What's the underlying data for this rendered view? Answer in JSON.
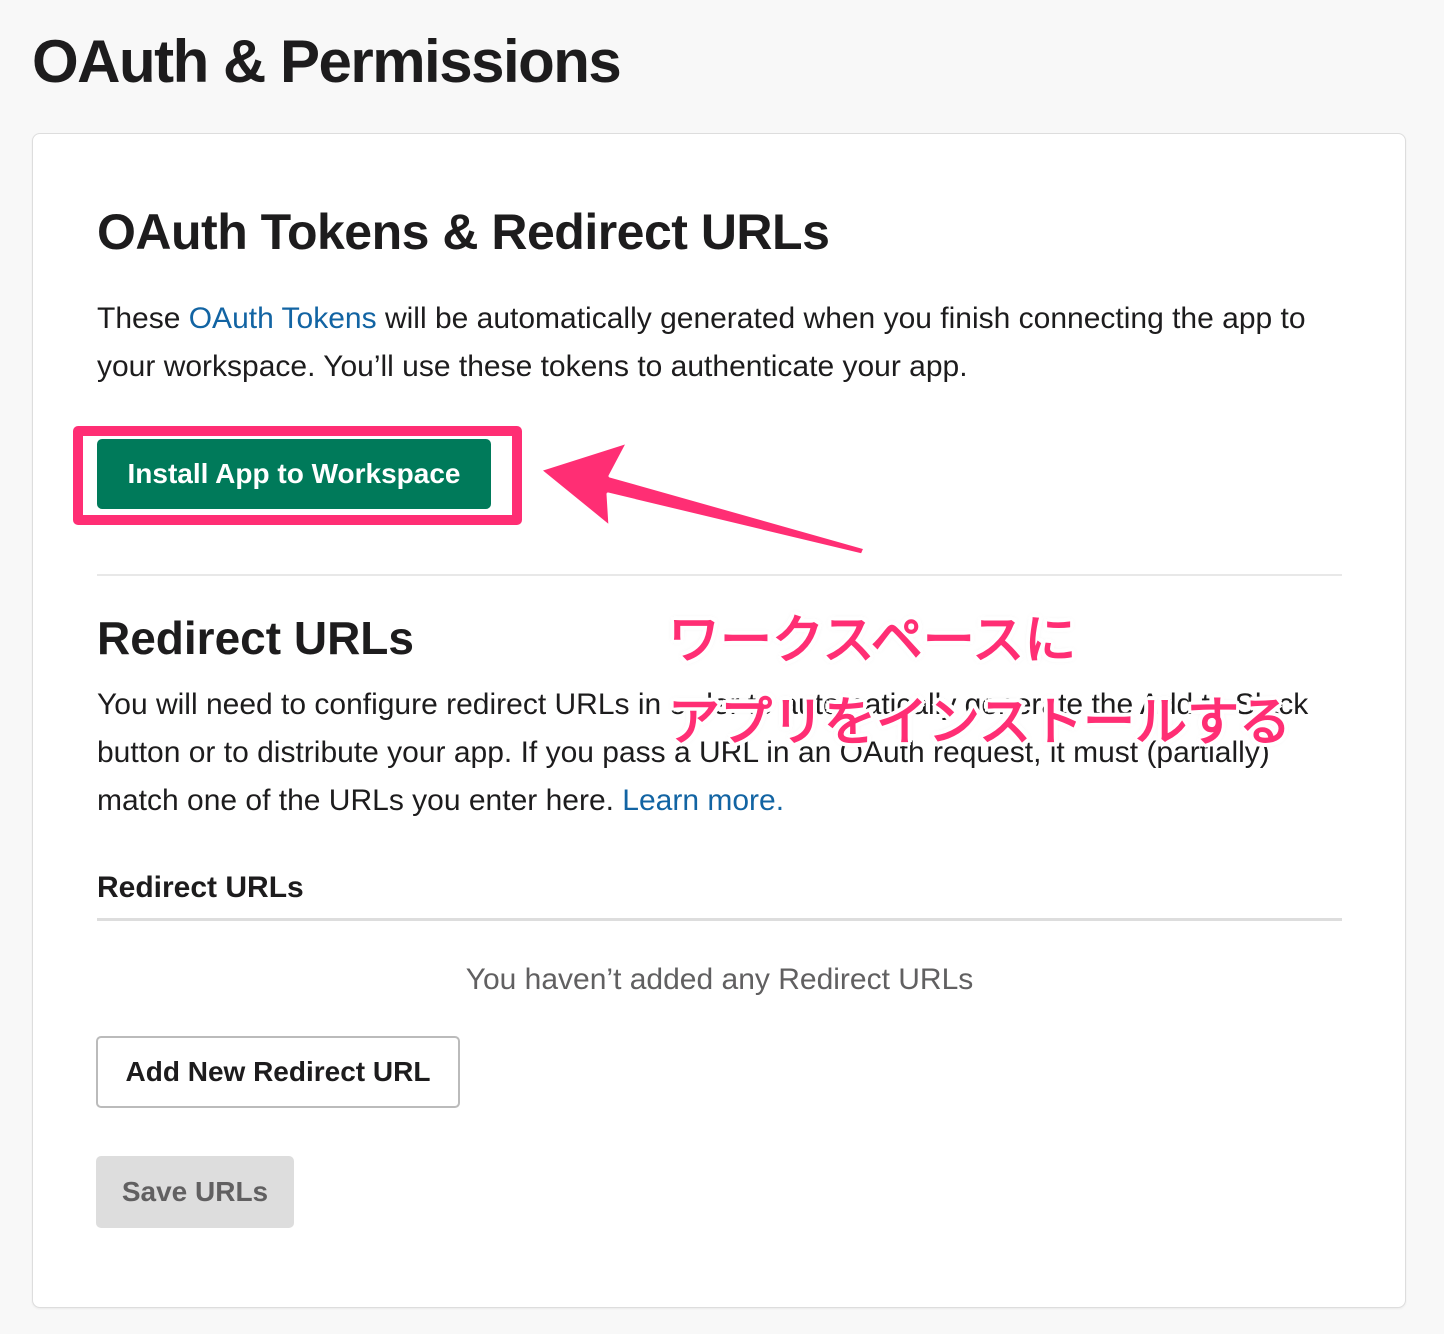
{
  "page": {
    "title": "OAuth & Permissions"
  },
  "tokens_section": {
    "title": "OAuth Tokens & Redirect URLs",
    "description_prefix": "These ",
    "description_link": "OAuth Tokens",
    "description_suffix": " will be automatically generated when you finish connecting the app to your workspace. You’ll use these tokens to authenticate your app.",
    "install_button": "Install App to Workspace"
  },
  "redirect_section": {
    "title": "Redirect URLs",
    "description": "You will need to configure redirect URLs in order to automatically generate the Add to Slack button or to distribute your app. If you pass a URL in an OAuth request, it must (partially) match one of the URLs you enter here. ",
    "learn_more_link": "Learn more.",
    "field_label": "Redirect URLs",
    "empty_state": "You haven’t added any Redirect URLs",
    "add_button": "Add New Redirect URL",
    "save_button": "Save URLs"
  },
  "annotation": {
    "line1": "ワークスペースに",
    "line2": "アプリをインストールする",
    "color": "#ff2e74"
  },
  "colors": {
    "install_button": "#007a5a",
    "link": "#1264a3",
    "highlight": "#ff2e74"
  }
}
